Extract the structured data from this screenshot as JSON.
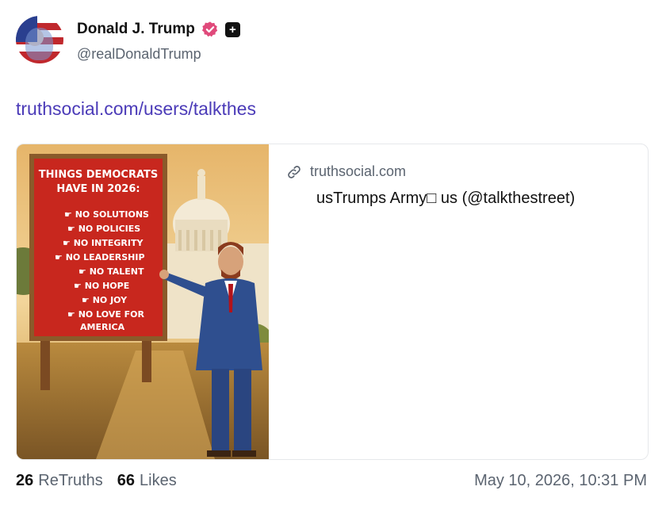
{
  "author": {
    "display_name": "Donald J. Trump",
    "handle": "@realDonaldTrump",
    "avatar_icon": "avatar-image",
    "verified_icon": "verified-badge-icon",
    "plus_icon": "plus-badge-icon",
    "verified_color": "#e04a7b"
  },
  "post": {
    "link_text": "truthsocial.com/users/talkthes",
    "link_color": "#4b3bb8"
  },
  "card": {
    "domain": "truthsocial.com",
    "title": "usTrumps Army□ us (@talkthestreet)",
    "image": {
      "sign_title": "THINGS DEMOCRATS HAVE IN 2026:",
      "sign_items": [
        "NO SOLUTIONS",
        "NO POLICIES",
        "NO INTEGRITY",
        "NO LEADERSHIP",
        "NO TALENT",
        "NO HOPE",
        "NO JOY",
        "NO LOVE FOR AMERICA"
      ]
    }
  },
  "stats": {
    "retruths_count": "26",
    "retruths_label": "ReTruths",
    "likes_count": "66",
    "likes_label": "Likes"
  },
  "timestamp": "May 10, 2026, 10:31 PM"
}
